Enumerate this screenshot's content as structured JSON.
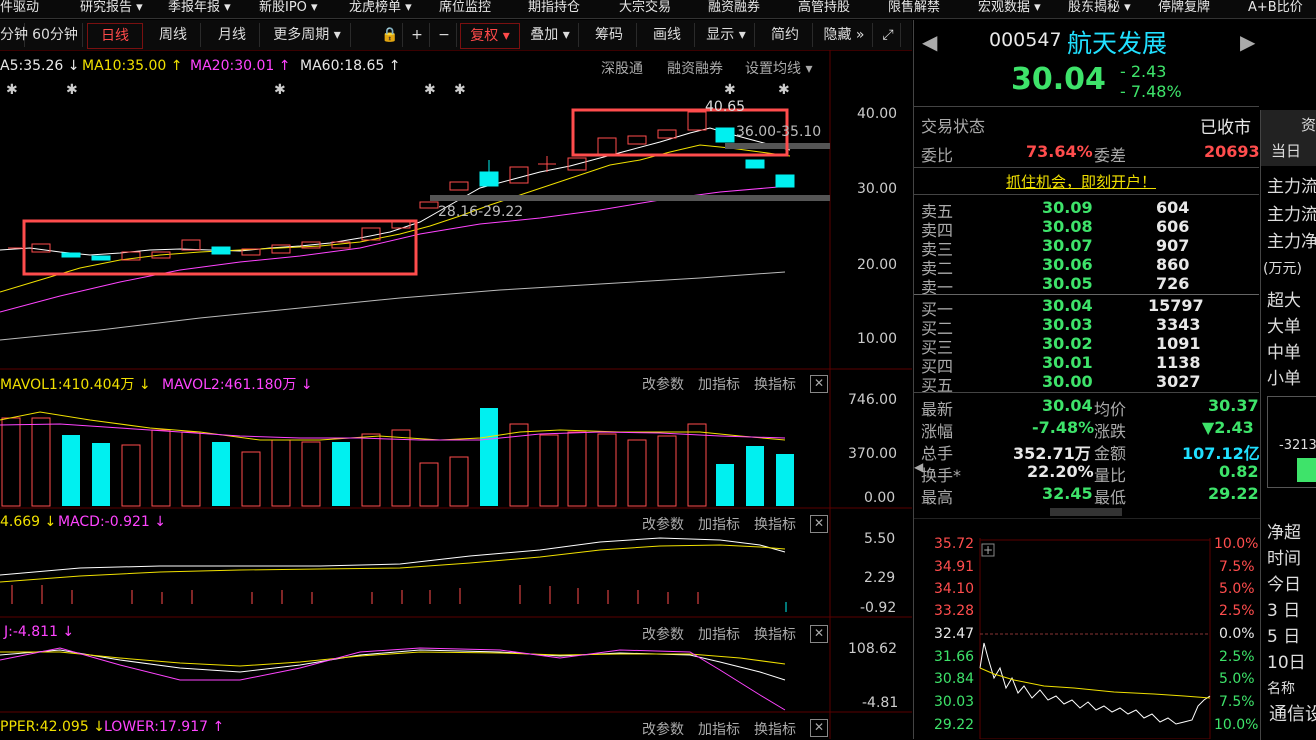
{
  "topnav": [
    "件驱动",
    "研究报告 ▾",
    "季报年报 ▾",
    "新股IPO ▾",
    "龙虎榜单 ▾",
    "席位监控",
    "期指持仓",
    "大宗交易",
    "融资融券",
    "高管持股",
    "限售解禁",
    "宏观数据 ▾",
    "股东揭秘 ▾",
    "停牌复牌",
    "A+B比价"
  ],
  "toolbar": {
    "min": "分钟",
    "min60": "60分钟",
    "day": "日线",
    "week": "周线",
    "month": "月线",
    "more": "更多周期 ▾",
    "lock": "🔒",
    "plus": "+",
    "minus": "−",
    "fq": "复权 ▾",
    "overlay": "叠加 ▾",
    "chips": "筹码",
    "draw": "画线",
    "display": "显示 ▾",
    "simple": "简约",
    "hide": "隐藏 »",
    "expand": "⤢"
  },
  "ma_labels": {
    "ma5": "A5:35.26 ↓",
    "ma10": "MA10:35.00 ↑",
    "ma20": "MA20:30.01 ↑",
    "ma60": "MA60:18.65 ↑"
  },
  "links": {
    "sgt": "深股通",
    "rzrq": "融资融券",
    "setma": "设置均线 ▾"
  },
  "price_axis": [
    "40.00",
    "30.00",
    "20.00",
    "10.00"
  ],
  "annotations": {
    "high": "40.65",
    "range1": "36.00-35.10",
    "range2": "28.16-29.22"
  },
  "vol": {
    "vol1": "MAVOL1:410.404万 ↓",
    "vol2": "MAVOL2:461.180万 ↓",
    "axis": [
      "746.00",
      "370.00",
      "0.00"
    ]
  },
  "macd": {
    "dif": "4.669 ↓",
    "macd": "MACD:-0.921 ↓",
    "axis": [
      "5.50",
      "2.29",
      "-0.92"
    ]
  },
  "kdj": {
    "j": "J:-4.811 ↓",
    "axis": [
      "108.62",
      "-4.81"
    ]
  },
  "boll": {
    "upper": "PPER:42.095 ↓",
    "lower": "LOWER:17.917 ↑"
  },
  "panel_links": {
    "param": "改参数",
    "add": "加指标",
    "switch": "换指标",
    "close": "✕"
  },
  "stock": {
    "code": "000547",
    "name": "航天发展",
    "price": "30.04",
    "chg": "- 2.43",
    "pct": "- 7.48%"
  },
  "status": {
    "label": "交易状态",
    "value": "已收市",
    "wb_label": "委比",
    "wb": "73.64%",
    "wc_label": "委差",
    "wc": "20693"
  },
  "promo": "抓住机会，即刻开户！",
  "sells": [
    {
      "label": "卖五",
      "price": "30.09",
      "vol": "604"
    },
    {
      "label": "卖四",
      "price": "30.08",
      "vol": "606"
    },
    {
      "label": "卖三",
      "price": "30.07",
      "vol": "907"
    },
    {
      "label": "卖二",
      "price": "30.06",
      "vol": "860"
    },
    {
      "label": "卖一",
      "price": "30.05",
      "vol": "726"
    }
  ],
  "buys": [
    {
      "label": "买一",
      "price": "30.04",
      "vol": "15797"
    },
    {
      "label": "买二",
      "price": "30.03",
      "vol": "3343"
    },
    {
      "label": "买三",
      "price": "30.02",
      "vol": "1091"
    },
    {
      "label": "买四",
      "price": "30.01",
      "vol": "1138"
    },
    {
      "label": "买五",
      "price": "30.00",
      "vol": "3027"
    }
  ],
  "quote": {
    "latest_l": "最新",
    "latest": "30.04",
    "avg_l": "均价",
    "avg": "30.37",
    "pct_l": "涨幅",
    "pct": "-7.48%",
    "chg_l": "涨跌",
    "chg": "▼2.43",
    "vol_l": "总手",
    "vol": "352.71万",
    "amt_l": "金额",
    "amt": "107.12亿",
    "turn_l": "换手*",
    "turn": "22.20%",
    "vr_l": "量比",
    "vr": "0.82",
    "high_l": "最高",
    "high": "32.45",
    "low_l": "最低",
    "low": "29.22"
  },
  "intraday": {
    "left": [
      "35.72",
      "34.91",
      "34.10",
      "33.28",
      "32.47",
      "31.66",
      "30.84",
      "30.03",
      "29.22"
    ],
    "right": [
      "10.0%",
      "7.5%",
      "5.0%",
      "2.5%",
      "0.0%",
      "2.5%",
      "5.0%",
      "7.5%",
      "10.0%"
    ]
  },
  "sidebar": {
    "zi": "资",
    "today": "当日",
    "flow1": "主力流",
    "flow2": "主力流",
    "net": "主力净",
    "unit": "(万元)",
    "sizes": [
      "超大",
      "大单",
      "中单",
      "小单"
    ],
    "val": "-3213",
    "jc": "净超",
    "time": "时间",
    "days": [
      "今日",
      "3 日",
      "5 日",
      "10日"
    ],
    "name": "名称",
    "tx": "通信设"
  }
}
